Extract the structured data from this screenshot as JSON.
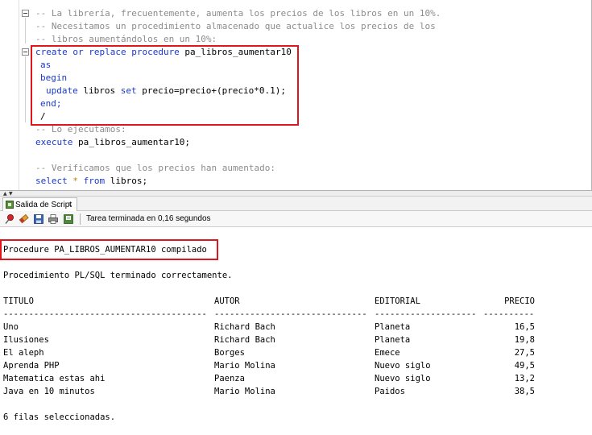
{
  "editor": {
    "comments_top": [
      "-- La librería, frecuentemente, aumenta los precios de los libros en un 10%.",
      "-- Necesitamos un procedimiento almacenado que actualice los precios de los",
      "-- libros aumentándolos en un 10%:"
    ],
    "proc": {
      "kw_create": "create or replace procedure",
      "name": " pa_libros_aumentar10",
      "kw_as": "as",
      "kw_begin": "begin",
      "kw_update": "update",
      "update_mid": " libros ",
      "kw_set": "set",
      "update_tail": " precio=precio+(precio*0.1);",
      "kw_end": "end;",
      "slash": "/"
    },
    "comment_exec": "-- Lo ejecutamos:",
    "exec": {
      "kw": "execute",
      "rest": " pa_libros_aumentar10;"
    },
    "comment_verify": "-- Verificamos que los precios han aumentado:",
    "select": {
      "kw_select": "select",
      "star": " * ",
      "kw_from": "from",
      "rest": " libros;"
    }
  },
  "panel": {
    "tab_label": "Salida de Script",
    "tab_close": "x",
    "status": "Tarea terminada en 0,16 segundos"
  },
  "output": {
    "compiled": "Procedure PA_LIBROS_AUMENTAR10 compilado",
    "plsql_done": "Procedimiento PL/SQL terminado correctamente.",
    "columns": [
      "TITULO",
      "AUTOR",
      "EDITORIAL",
      "PRECIO"
    ],
    "dashes": [
      "----------------------------------------",
      "------------------------------",
      "--------------------",
      "----------"
    ],
    "rows": [
      [
        "Uno",
        "Richard Bach",
        "Planeta",
        "16,5"
      ],
      [
        "Ilusiones",
        "Richard Bach",
        "Planeta",
        "19,8"
      ],
      [
        "El aleph",
        "Borges",
        "Emece",
        "27,5"
      ],
      [
        "Aprenda PHP",
        "Mario Molina",
        "Nuevo siglo",
        "49,5"
      ],
      [
        "Matematica estas ahi",
        "Paenza",
        "Nuevo siglo",
        "13,2"
      ],
      [
        "Java en 10 minutos",
        "Mario Molina",
        "Paidos",
        "38,5"
      ]
    ],
    "footer": "6 filas seleccionadas."
  },
  "colors": {
    "keyword": "#1b39c9",
    "comment": "#8c8c8c",
    "highlight_box": "#e0161d"
  },
  "icons": [
    "pin-icon",
    "eraser-icon",
    "save-icon",
    "print-icon",
    "save-file-icon"
  ]
}
